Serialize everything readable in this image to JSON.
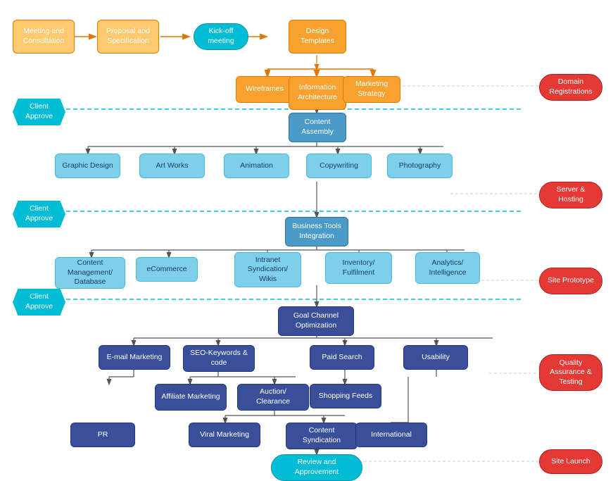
{
  "nodes": {
    "meeting": {
      "label": "Meeting and\nConsultation",
      "type": "orange-light"
    },
    "proposal": {
      "label": "Proposal and\nSpecification",
      "type": "orange-light"
    },
    "kickoff": {
      "label": "Kick-off\nmeeting",
      "type": "cyan"
    },
    "design_templates": {
      "label": "Design\nTemplates",
      "type": "orange"
    },
    "wireframes": {
      "label": "Wireframes",
      "type": "orange"
    },
    "info_arch": {
      "label": "Information\nArchitecture",
      "type": "orange"
    },
    "marketing_strat": {
      "label": "Marketing\nStrategy",
      "type": "orange"
    },
    "domain_reg": {
      "label": "Domain\nRegistrations",
      "type": "red"
    },
    "client_approve1": {
      "label": "Client\nApprove",
      "type": "client-approve"
    },
    "content_assembly": {
      "label": "Content\nAssembly",
      "type": "mid-blue"
    },
    "graphic_design": {
      "label": "Graphic Design",
      "type": "light-blue"
    },
    "art_works": {
      "label": "Art Works",
      "type": "light-blue"
    },
    "animation": {
      "label": "Animation",
      "type": "light-blue"
    },
    "copywriting": {
      "label": "Copywriting",
      "type": "light-blue"
    },
    "photography": {
      "label": "Photography",
      "type": "light-blue"
    },
    "client_approve2": {
      "label": "Client\nApprove",
      "type": "client-approve"
    },
    "server_hosting": {
      "label": "Server & Hosting",
      "type": "red"
    },
    "biz_tools": {
      "label": "Business Tools\nIntegration",
      "type": "mid-blue"
    },
    "content_mgmt": {
      "label": "Content\nManagement/\nDatabase",
      "type": "light-blue"
    },
    "ecommerce": {
      "label": "eCommerce",
      "type": "light-blue"
    },
    "intranet": {
      "label": "Intranet\nSyndication/\nWikis",
      "type": "light-blue"
    },
    "inventory": {
      "label": "Inventory/\nFulfilment",
      "type": "light-blue"
    },
    "analytics": {
      "label": "Analytics/\nIntelligence",
      "type": "light-blue"
    },
    "client_approve3": {
      "label": "Client\nApprove",
      "type": "client-approve"
    },
    "site_prototype": {
      "label": "Site Prototype",
      "type": "red"
    },
    "goal_channel": {
      "label": "Goal Channel\nOptimization",
      "type": "dark-blue"
    },
    "email_mktg": {
      "label": "E-mail Marketing",
      "type": "dark-blue"
    },
    "seo": {
      "label": "SEO-Keywords &\ncode",
      "type": "dark-blue"
    },
    "paid_search": {
      "label": "Paid Search",
      "type": "dark-blue"
    },
    "usability": {
      "label": "Usability",
      "type": "dark-blue"
    },
    "affiliate": {
      "label": "Affiliate\nMarketing",
      "type": "dark-blue"
    },
    "auction": {
      "label": "Auction/\nClearance",
      "type": "dark-blue"
    },
    "shopping_feeds": {
      "label": "Shopping Feeds",
      "type": "dark-blue"
    },
    "qa_testing": {
      "label": "Quality\nAssurance &\nTesting",
      "type": "red"
    },
    "pr": {
      "label": "PR",
      "type": "dark-blue"
    },
    "viral_mktg": {
      "label": "Viral Marketing",
      "type": "dark-blue"
    },
    "content_syndication": {
      "label": "Content\nSyndication",
      "type": "dark-blue"
    },
    "international": {
      "label": "International",
      "type": "dark-blue"
    },
    "review": {
      "label": "Review and\nApprovement",
      "type": "cyan"
    },
    "site_launch": {
      "label": "Site Launch",
      "type": "red"
    }
  }
}
